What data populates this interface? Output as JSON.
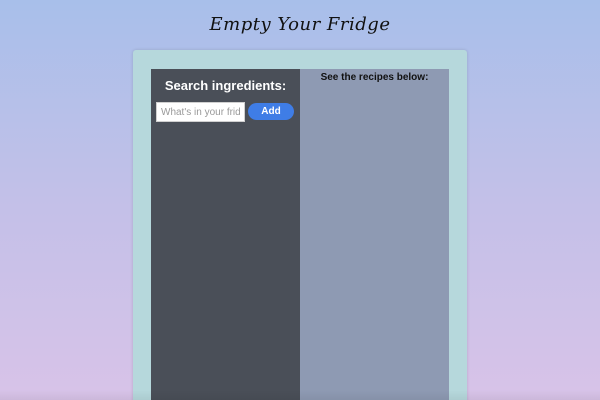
{
  "app": {
    "title": "Empty Your Fridge"
  },
  "search": {
    "heading": "Search ingredients:",
    "placeholder": "What's in your fridge?",
    "value": "",
    "add_label": "Add"
  },
  "recipes": {
    "heading": "See the recipes below:"
  },
  "colors": {
    "background_top": "#a8bfea",
    "background_bottom": "#d8c3e8",
    "panel": "#b6d8dc",
    "left_column": "#4a4f58",
    "right_column": "#8e9ab3",
    "accent": "#3f7de6"
  }
}
